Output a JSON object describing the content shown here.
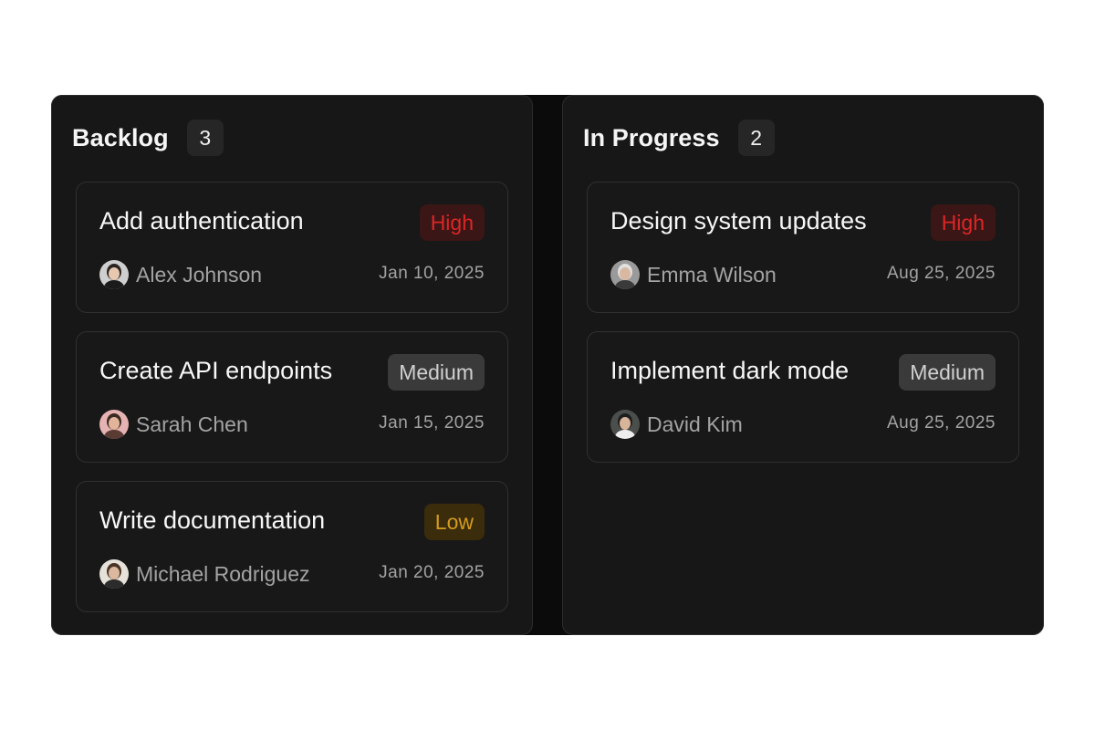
{
  "columns": [
    {
      "title": "Backlog",
      "count": "3",
      "cards": [
        {
          "title": "Add authentication",
          "priority": "High",
          "priority_level": "high",
          "assignee": "Alex Johnson",
          "date": "Jan 10, 2025",
          "avatar_colors": {
            "bg": "#cfcfcf",
            "skin": "#e8c9b0",
            "hair": "#2a2522",
            "shirt": "#1b1b1b"
          }
        },
        {
          "title": "Create API endpoints",
          "priority": "Medium",
          "priority_level": "medium",
          "assignee": "Sarah Chen",
          "date": "Jan 15, 2025",
          "avatar_colors": {
            "bg": "#e6b2b2",
            "skin": "#e2b59a",
            "hair": "#3a2a22",
            "shirt": "#5a3b33"
          }
        },
        {
          "title": "Write documentation",
          "priority": "Low",
          "priority_level": "low",
          "assignee": "Michael Rodriguez",
          "date": "Jan 20, 2025",
          "avatar_colors": {
            "bg": "#e6e2da",
            "skin": "#dcb89e",
            "hair": "#4a3426",
            "shirt": "#2b2b2b"
          }
        }
      ]
    },
    {
      "title": "In Progress",
      "count": "2",
      "cards": [
        {
          "title": "Design system updates",
          "priority": "High",
          "priority_level": "high",
          "assignee": "Emma Wilson",
          "date": "Aug 25, 2025",
          "avatar_colors": {
            "bg": "#9a9a9a",
            "skin": "#d9b8a2",
            "hair": "#e0e0e0",
            "shirt": "#3a3a3a"
          }
        },
        {
          "title": "Implement dark mode",
          "priority": "Medium",
          "priority_level": "medium",
          "assignee": "David Kim",
          "date": "Aug 25, 2025",
          "avatar_colors": {
            "bg": "#4a4f4c",
            "skin": "#d8b49a",
            "hair": "#1e1e1e",
            "shirt": "#eeeeee"
          }
        }
      ]
    }
  ],
  "colors": {
    "board_bg": "#0b0b0b",
    "column_bg": "#171717",
    "priority_high": "#dc2626",
    "priority_medium": "#d0d0d0",
    "priority_low": "#d49b1c"
  }
}
